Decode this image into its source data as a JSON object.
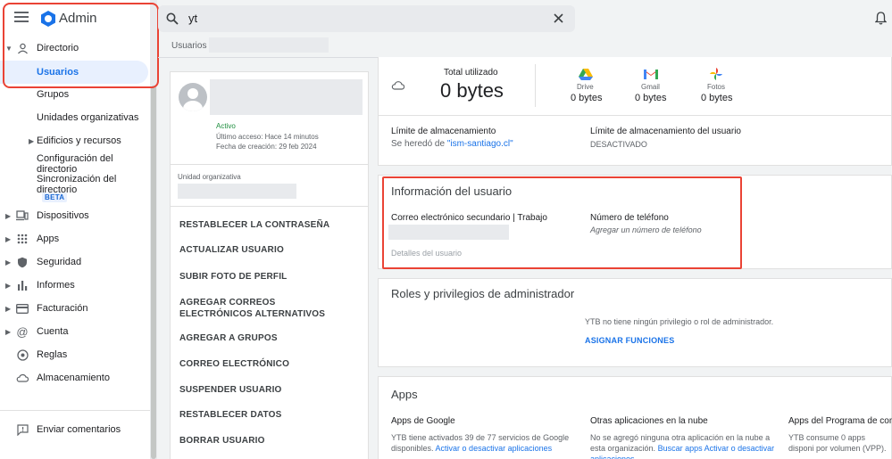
{
  "app": {
    "brand": "Admin"
  },
  "search": {
    "value": "yt"
  },
  "breadcrumb": {
    "label": "Usuarios"
  },
  "sidebar": {
    "items": [
      {
        "label": "Directorio",
        "icon": "person-icon"
      },
      {
        "label": "Usuarios"
      },
      {
        "label": "Grupos"
      },
      {
        "label": "Unidades organizativas"
      },
      {
        "label": "Edificios y recursos"
      },
      {
        "label": "Configuración del directorio"
      },
      {
        "label": "Sincronización del directorio",
        "badge": "BETA"
      },
      {
        "label": "Dispositivos",
        "icon": "devices-icon"
      },
      {
        "label": "Apps",
        "icon": "apps-grid-icon"
      },
      {
        "label": "Seguridad",
        "icon": "shield-icon"
      },
      {
        "label": "Informes",
        "icon": "bar-chart-icon"
      },
      {
        "label": "Facturación",
        "icon": "credit-card-icon"
      },
      {
        "label": "Cuenta",
        "icon": "at-sign-icon"
      },
      {
        "label": "Reglas",
        "icon": "compass-icon"
      },
      {
        "label": "Almacenamiento",
        "icon": "cloud-icon"
      }
    ],
    "feedback": "Enviar comentarios"
  },
  "profile": {
    "status": "Activo",
    "last_access": "Último acceso: Hace 14 minutos",
    "created": "Fecha de creación: 29 feb 2024",
    "org_unit_label": "Unidad organizativa"
  },
  "actions": [
    "RESTABLECER LA CONTRASEÑA",
    "ACTUALIZAR USUARIO",
    "SUBIR FOTO DE PERFIL",
    "AGREGAR CORREOS ELECTRÓNICOS ALTERNATIVOS",
    "AGREGAR A GRUPOS",
    "CORREO ELECTRÓNICO",
    "SUSPENDER USUARIO",
    "RESTABLECER DATOS",
    "BORRAR USUARIO"
  ],
  "storage": {
    "total_label": "Total utilizado",
    "total_value": "0 bytes",
    "apps": [
      {
        "name": "Drive",
        "value": "0 bytes",
        "icon": "drive-icon"
      },
      {
        "name": "Gmail",
        "value": "0 bytes",
        "icon": "gmail-icon"
      },
      {
        "name": "Fotos",
        "value": "0 bytes",
        "icon": "photos-icon"
      }
    ],
    "limit_title": "Límite de almacenamiento",
    "inherited_prefix": "Se heredó de ",
    "inherited_link": "\"ism-santiago.cl\"",
    "user_limit_title": "Límite de almacenamiento del usuario",
    "user_limit_value": "DESACTIVADO"
  },
  "user_info": {
    "title": "Información del usuario",
    "secondary_email_label": "Correo electrónico secundario | Trabajo",
    "phone_label": "Número de teléfono",
    "phone_placeholder": "Agregar un número de teléfono",
    "details_link": "Detalles del usuario"
  },
  "roles": {
    "title": "Roles y privilegios de administrador",
    "message": "YTB no tiene ningún privilegio o rol de administrador.",
    "assign": "ASIGNAR FUNCIONES"
  },
  "apps_section": {
    "title": "Apps",
    "google": {
      "title": "Apps de Google",
      "text": "YTB tiene activados 39 de 77 servicios de Google disponibles.",
      "link": "Activar o desactivar aplicaciones"
    },
    "cloud": {
      "title": "Otras aplicaciones en la nube",
      "text": "No se agregó ninguna otra aplicación en la nube a esta organización.",
      "link1": "Buscar apps",
      "link2": "Activar o desactivar aplicaciones"
    },
    "vpp": {
      "title": "Apps del Programa de comp",
      "text": "YTB consume 0 apps disponi por volumen (VPP)."
    }
  },
  "colors": {
    "accent": "#1a73e8",
    "active_status": "#1e8e3e",
    "highlight": "#ea4335"
  }
}
